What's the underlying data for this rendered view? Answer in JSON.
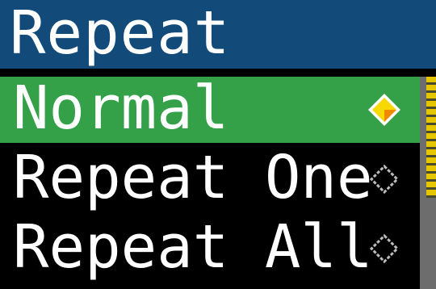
{
  "header": {
    "title": "Repeat"
  },
  "options": [
    {
      "label": "Normal",
      "selected": true,
      "icon": "diamond-selected-icon"
    },
    {
      "label": "Repeat One",
      "selected": false,
      "icon": "diamond-outline-icon"
    },
    {
      "label": "Repeat All",
      "selected": false,
      "icon": "diamond-outline-icon"
    }
  ],
  "colors": {
    "header_bg": "#124a7a",
    "selected_bg": "#34a148",
    "background": "#000000",
    "diamond_fill": "#f7d800",
    "diamond_accent": "#f08a00",
    "scrollbar_track": "#6d6d6d",
    "scrollbar_thumb": "#e6c600"
  }
}
